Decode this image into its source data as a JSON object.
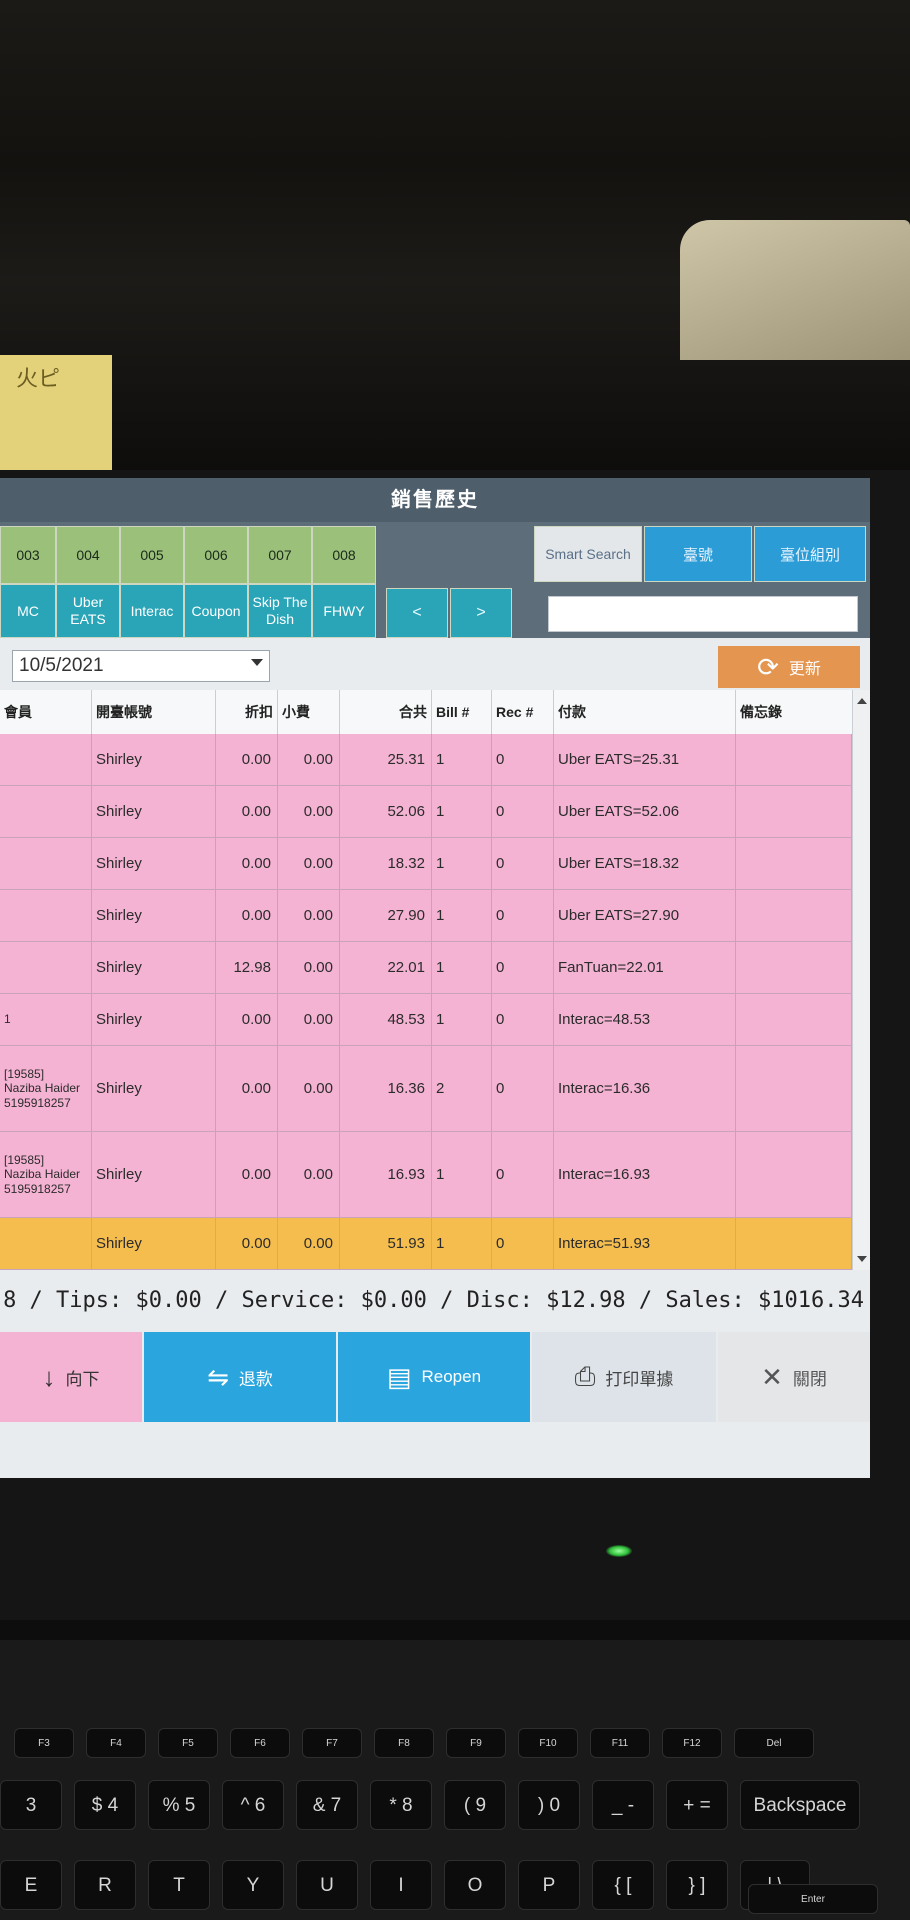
{
  "window": {
    "title": "銷售歷史"
  },
  "sticky_note": "火ピ",
  "filters": {
    "row1": [
      "003",
      "004",
      "005",
      "006",
      "007",
      "008"
    ],
    "row2": [
      "MC",
      "Uber EATS",
      "Interac",
      "Coupon",
      "Skip The Dish",
      "FHWY"
    ],
    "nav_prev": "<",
    "nav_next": ">",
    "smart_search": "Smart Search",
    "btn_table": "臺號",
    "btn_table_group": "臺位組別",
    "search_value": ""
  },
  "date_picker": {
    "value": "10/5/2021"
  },
  "refresh": {
    "label": "更新"
  },
  "table": {
    "columns": [
      "會員",
      "開臺帳號",
      "折扣",
      "小費",
      "合共",
      "Bill #",
      "Rec #",
      "付款",
      "備忘錄"
    ],
    "rows": [
      {
        "member": "",
        "account": "Shirley",
        "discount": "0.00",
        "tips": "0.00",
        "total": "25.31",
        "bill": "1",
        "rec": "0",
        "payment": "Uber EATS=25.31",
        "memo": "",
        "color": "pink"
      },
      {
        "member": "",
        "account": "Shirley",
        "discount": "0.00",
        "tips": "0.00",
        "total": "52.06",
        "bill": "1",
        "rec": "0",
        "payment": "Uber EATS=52.06",
        "memo": "",
        "color": "pink"
      },
      {
        "member": "",
        "account": "Shirley",
        "discount": "0.00",
        "tips": "0.00",
        "total": "18.32",
        "bill": "1",
        "rec": "0",
        "payment": "Uber EATS=18.32",
        "memo": "",
        "color": "pink"
      },
      {
        "member": "",
        "account": "Shirley",
        "discount": "0.00",
        "tips": "0.00",
        "total": "27.90",
        "bill": "1",
        "rec": "0",
        "payment": "Uber EATS=27.90",
        "memo": "",
        "color": "pink"
      },
      {
        "member": "",
        "account": "Shirley",
        "discount": "12.98",
        "tips": "0.00",
        "total": "22.01",
        "bill": "1",
        "rec": "0",
        "payment": "FanTuan=22.01",
        "memo": "",
        "color": "pink"
      },
      {
        "member": "1",
        "account": "Shirley",
        "discount": "0.00",
        "tips": "0.00",
        "total": "48.53",
        "bill": "1",
        "rec": "0",
        "payment": "Interac=48.53",
        "memo": "",
        "color": "pink"
      },
      {
        "member": "[19585]\nNaziba Haider\n5195918257",
        "account": "Shirley",
        "discount": "0.00",
        "tips": "0.00",
        "total": "16.36",
        "bill": "2",
        "rec": "0",
        "payment": "Interac=16.36",
        "memo": "",
        "color": "pink"
      },
      {
        "member": "[19585]\nNaziba Haider\n5195918257",
        "account": "Shirley",
        "discount": "0.00",
        "tips": "0.00",
        "total": "16.93",
        "bill": "1",
        "rec": "0",
        "payment": "Interac=16.93",
        "memo": "",
        "color": "pink"
      },
      {
        "member": "",
        "account": "Shirley",
        "discount": "0.00",
        "tips": "0.00",
        "total": "51.93",
        "bill": "1",
        "rec": "0",
        "payment": "Interac=51.93",
        "memo": "",
        "color": "yellow"
      }
    ]
  },
  "summary": "8 / Tips: $0.00 / Service: $0.00 / Disc: $12.98 / Sales: $1016.34",
  "actions": {
    "down": "向下",
    "refund": "退款",
    "reopen": "Reopen",
    "print": "打印單據",
    "close": "關閉"
  },
  "icons": {
    "down": "arrow-down-icon",
    "refund": "refund-icon",
    "reopen": "receipt-icon",
    "print": "printer-icon",
    "close": "close-icon",
    "refresh": "refresh-icon"
  },
  "colors": {
    "pink_row": "#f5b3d4",
    "selected_row": "#f4bd4e",
    "green_button": "#9bc07a",
    "teal_button": "#2aa5b8",
    "refresh_button": "#e49550",
    "action_blue": "#2aa5de"
  },
  "keyboard": {
    "fn_row": [
      "F3",
      "F4",
      "F5",
      "F6",
      "F7",
      "F8",
      "F9",
      "F10",
      "F11",
      "F12",
      "Del"
    ],
    "num_row": [
      "3",
      "$ 4",
      "% 5",
      "^ 6",
      "& 7",
      "* 8",
      "( 9",
      ") 0",
      "_ -",
      "+ =",
      "Backspace"
    ],
    "letter_row": [
      "E",
      "R",
      "T",
      "Y",
      "U",
      "I",
      "O",
      "P",
      "{ [",
      "} ]",
      "| \\"
    ],
    "bottom_right": "Enter"
  }
}
